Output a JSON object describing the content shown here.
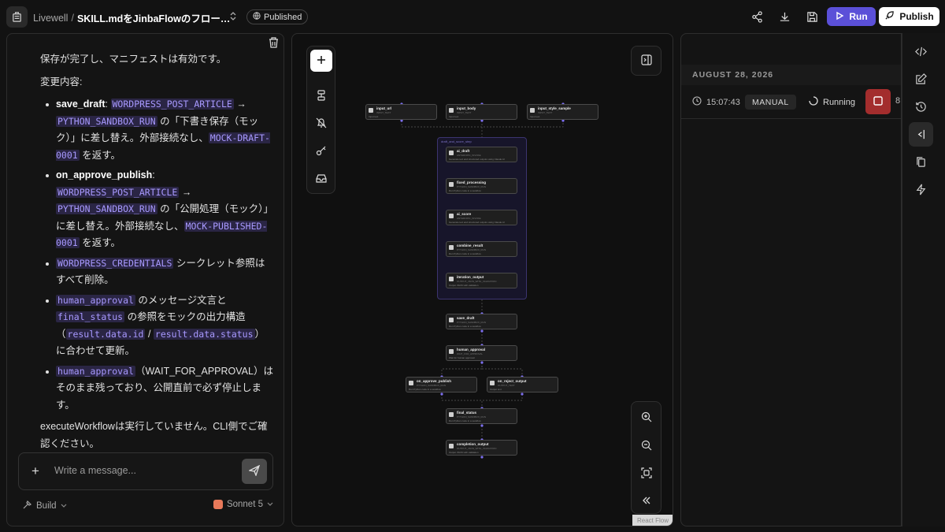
{
  "header": {
    "org": "Livewell",
    "sep": "/",
    "workflow_title": "SKILL.mdをJinbaFlowのフロー…",
    "status_badge": "Published",
    "run_label": "Run",
    "publish_label": "Publish"
  },
  "chat": {
    "intro": "保存が完了し、マニフェストは有効です。",
    "changes_heading": "変更内容:",
    "items": [
      {
        "key": "save_draft",
        "c1": "WORDPRESS_POST_ARTICLE",
        "arrow": "→",
        "c2": "PYTHON_SANDBOX_RUN",
        "t1": "の「下書き保存（モック）」に差し替え。外部接続なし、",
        "c3": "MOCK-DRAFT-0001",
        "t2": "を返す。"
      },
      {
        "key": "on_approve_publish",
        "c1": "WORDPRESS_POST_ARTICLE",
        "arrow": "→",
        "c2": "PYTHON_SANDBOX_RUN",
        "t1": "の「公開処理（モック）」に差し替え。外部接続なし、",
        "c3": "MOCK-PUBLISHED-0001",
        "t2": "を返す。"
      }
    ],
    "item3": {
      "c1": "WORDPRESS_CREDENTIALS",
      "t1": "シークレット参照はすべて削除。"
    },
    "item4": {
      "c1": "human_approval",
      "t1": "のメッセージ文言と",
      "c2": "final_status",
      "t2": "の参照をモックの出力構造（",
      "c3": "result.data.id",
      "slash": "/",
      "c4": "result.data.status",
      "t3": "）に合わせて更新。"
    },
    "item5": {
      "c1": "human_approval",
      "t1": "（WAIT_FOR_APPROVAL）はそのまま残っており、公開直前で必ず停止します。"
    },
    "outro": "executeWorkflowは実行していません。CLI側でご確認ください。",
    "composer_placeholder": "Write a message...",
    "mode": "Build",
    "model": "Sonnet 5"
  },
  "flow": {
    "group_label": "draft_and_score_step",
    "nodes": [
      {
        "id": "input_url",
        "name": "input_url",
        "sub": "INPUT_TEXT",
        "desc": "Input text"
      },
      {
        "id": "input_body",
        "name": "input_body",
        "sub": "INPUT_TEXT",
        "desc": "Input text"
      },
      {
        "id": "input_style_sample",
        "name": "input_style_sample",
        "sub": "INPUT_TEXT",
        "desc": "Input text"
      },
      {
        "id": "ai_draft",
        "name": "ai_draft",
        "sub": "ANTHROPIC_INVOKE",
        "desc": "Generate text and structured outputs using Claude AI"
      },
      {
        "id": "fixed_processing",
        "name": "fixed_processing",
        "sub": "PYTHON_SANDBOX_RUN",
        "desc": "Run Python code in a sandbox"
      },
      {
        "id": "ai_score",
        "name": "ai_score",
        "sub": "ANTHROPIC_INVOKE",
        "desc": "Generate text and structured outputs using Claude AI"
      },
      {
        "id": "combine_result",
        "name": "combine_result",
        "sub": "PYTHON_SANDBOX_RUN",
        "desc": "Run Python code in a sandbox"
      },
      {
        "id": "iteration_output",
        "name": "iteration_output",
        "sub": "OUTPUT_JSON_WITH_VALIDATION",
        "desc": "Output JSON with validation"
      },
      {
        "id": "save_draft",
        "name": "save_draft",
        "sub": "PYTHON_SANDBOX_RUN",
        "desc": "Run Python code in a sandbox"
      },
      {
        "id": "human_approval",
        "name": "human_approval",
        "sub": "WAIT_FOR_APPROVAL",
        "desc": "Wait for human approval"
      },
      {
        "id": "on_approve_publish",
        "name": "on_approve_publish",
        "sub": "PYTHON_SANDBOX_RUN",
        "desc": "Run Python code in a sandbox"
      },
      {
        "id": "on_reject_output",
        "name": "on_reject_output",
        "sub": "OUTPUT_TEXT",
        "desc": "Output text"
      },
      {
        "id": "final_status",
        "name": "final_status",
        "sub": "PYTHON_SANDBOX_RUN",
        "desc": "Run Python code in a sandbox"
      },
      {
        "id": "completion_output",
        "name": "completion_output",
        "sub": "OUTPUT_JSON_WITH_VALIDATION",
        "desc": "Output JSON with validation"
      }
    ],
    "watermark": "React Flow"
  },
  "runs": {
    "date": "AUGUST 28, 2026",
    "time": "15:07:43",
    "trigger": "MANUAL",
    "status": "Running",
    "count": "8"
  },
  "colors": {
    "accent": "#5b50d8",
    "code_text": "#a899ff",
    "stop": "#a32d2d"
  },
  "icons": [
    "app-logo-icon",
    "chevron-updown-icon",
    "globe-icon",
    "share-icon",
    "download-icon",
    "save-icon",
    "play-icon",
    "rocket-icon",
    "trash-icon",
    "copy-icon",
    "plus-icon",
    "send-icon",
    "hammer-icon",
    "chevron-down-icon",
    "layers-icon",
    "bell-off-icon",
    "key-icon",
    "inbox-icon",
    "panel-icon",
    "zoom-in-icon",
    "zoom-out-icon",
    "fit-view-icon",
    "collapse-icon",
    "clock-icon",
    "spinner-icon",
    "stop-icon",
    "code-icon",
    "edit-icon",
    "history-icon",
    "panel-right-icon",
    "copy-doc-icon",
    "lightning-icon"
  ]
}
